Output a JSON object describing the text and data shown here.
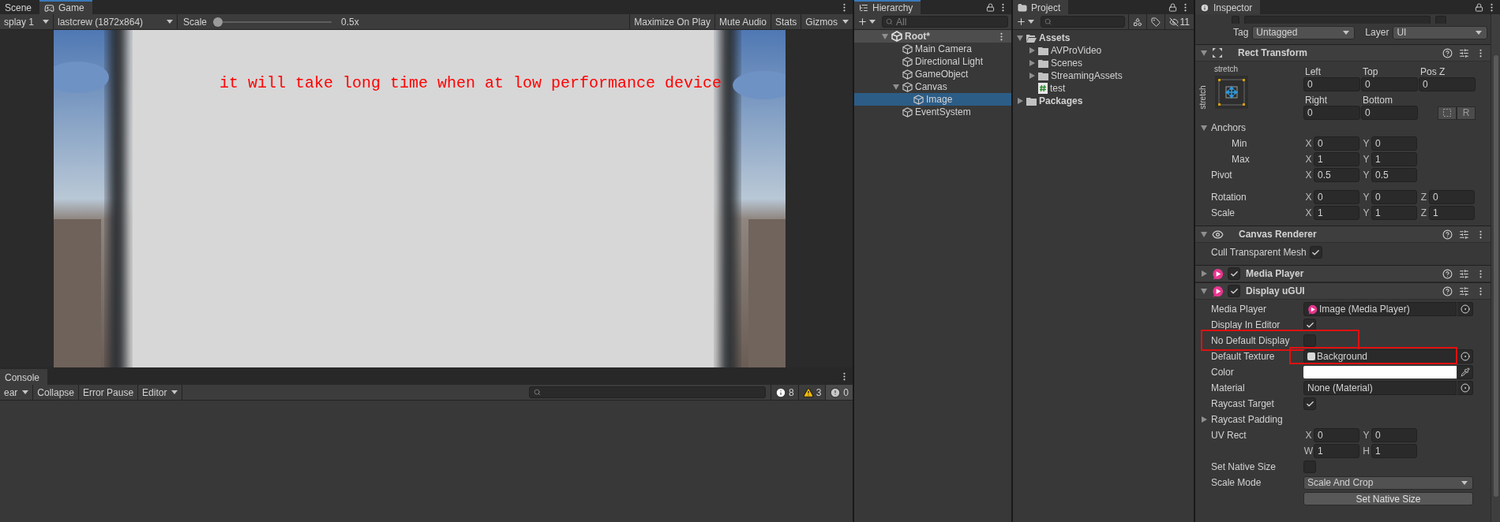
{
  "game_panel": {
    "tabs": [
      {
        "label": "Scene",
        "selected": false
      },
      {
        "label": "Game",
        "selected": true
      }
    ],
    "display": "splay 1",
    "resolution": "lastcrew (1872x864)",
    "scale": {
      "label": "Scale",
      "level": 0,
      "reading": "0.5x"
    },
    "toolbar_buttons": [
      {
        "label": "Maximize On Play",
        "dropdown": false
      },
      {
        "label": "Mute Audio",
        "dropdown": false
      },
      {
        "label": "Stats",
        "dropdown": false
      },
      {
        "label": "Gizmos",
        "dropdown": true
      }
    ],
    "game_text": "it will take long time when at low performance device"
  },
  "console": {
    "tab": "Console",
    "buttons": [
      {
        "label": "ear",
        "dropdown": true
      },
      {
        "label": "Collapse",
        "dropdown": false
      },
      {
        "label": "Error Pause",
        "dropdown": false
      },
      {
        "label": "Editor",
        "dropdown": true
      }
    ],
    "counts": [
      {
        "kind": "info",
        "value": "8"
      },
      {
        "kind": "warning",
        "value": "3"
      },
      {
        "kind": "error",
        "value": "0"
      }
    ]
  },
  "hierarchy": {
    "title": "Hierarchy",
    "search_placeholder": "All",
    "tree": [
      {
        "label": "Root*",
        "kind": "scene",
        "expanded": true,
        "selected": false,
        "children": [
          {
            "label": "Main Camera",
            "kind": "object",
            "selected": false
          },
          {
            "label": "Directional Light",
            "kind": "object",
            "selected": false
          },
          {
            "label": "GameObject",
            "kind": "object",
            "selected": false
          },
          {
            "label": "Canvas",
            "kind": "object",
            "selected": false,
            "expanded": true,
            "children": [
              {
                "label": "Image",
                "kind": "object",
                "selected": true
              }
            ]
          },
          {
            "label": "EventSystem",
            "kind": "object",
            "selected": false
          }
        ]
      }
    ]
  },
  "project": {
    "title": "Project",
    "hidden_count": "11",
    "tree": [
      {
        "label": "Assets",
        "kind": "folder",
        "expanded": true,
        "selected": false,
        "children": [
          {
            "label": "AVProVideo",
            "kind": "folder",
            "expanded": false,
            "selected": false
          },
          {
            "label": "Scenes",
            "kind": "folder",
            "expanded": false,
            "selected": false
          },
          {
            "label": "StreamingAssets",
            "kind": "folder",
            "expanded": false,
            "selected": false
          },
          {
            "label": "test",
            "kind": "script",
            "selected": false
          }
        ]
      },
      {
        "label": "Packages",
        "kind": "folder",
        "expanded": false,
        "selected": false
      }
    ]
  },
  "inspector": {
    "title": "Inspector",
    "tag_label": "Tag",
    "tag": "Untagged",
    "layer_label": "Layer",
    "layer": "UI",
    "components": [
      {
        "kind": "rect_transform",
        "title": "Rect Transform",
        "expanded": true,
        "preset": {
          "top": "stretch",
          "side": "stretch"
        },
        "offsets": [
          {
            "label": "Left",
            "value": "0"
          },
          {
            "label": "Top",
            "value": "0"
          },
          {
            "label": "Pos Z",
            "value": "0"
          },
          {
            "label": "Right",
            "value": "0"
          },
          {
            "label": "Bottom",
            "value": "0"
          }
        ],
        "raw_button": "R",
        "rows": [
          {
            "kind": "foldout",
            "label": "Anchors",
            "expanded": true,
            "children": [
              {
                "kind": "vector",
                "label": "Min",
                "fields": [
                  {
                    "axis": "X",
                    "value": "0"
                  },
                  {
                    "axis": "Y",
                    "value": "0"
                  }
                ]
              },
              {
                "kind": "vector",
                "label": "Max",
                "fields": [
                  {
                    "axis": "X",
                    "value": "1"
                  },
                  {
                    "axis": "Y",
                    "value": "1"
                  }
                ]
              }
            ]
          },
          {
            "kind": "vector",
            "label": "Pivot",
            "fields": [
              {
                "axis": "X",
                "value": "0.5"
              },
              {
                "axis": "Y",
                "value": "0.5"
              }
            ]
          }
        ],
        "transform_rows": [
          {
            "kind": "vector",
            "label": "Rotation",
            "fields": [
              {
                "axis": "X",
                "value": "0"
              },
              {
                "axis": "Y",
                "value": "0"
              },
              {
                "axis": "Z",
                "value": "0"
              }
            ]
          },
          {
            "kind": "vector",
            "label": "Scale",
            "fields": [
              {
                "axis": "X",
                "value": "1"
              },
              {
                "axis": "Y",
                "value": "1"
              },
              {
                "axis": "Z",
                "value": "1"
              }
            ]
          }
        ]
      },
      {
        "kind": "renderer",
        "title": "Canvas Renderer",
        "expanded": true,
        "rows": [
          {
            "kind": "check",
            "label": "Cull Transparent Mesh",
            "checked": true,
            "highlighted": false
          }
        ]
      },
      {
        "kind": "media",
        "title": "Media Player",
        "enabled": true,
        "expanded": false
      },
      {
        "kind": "media",
        "title": "Display uGUI",
        "enabled": true,
        "expanded": true,
        "rows": [
          {
            "kind": "media_object",
            "label": "Media Player",
            "value": "Image (Media Player)",
            "highlighted": false
          },
          {
            "kind": "check",
            "label": "Display In Editor",
            "checked": true,
            "highlighted": false
          },
          {
            "kind": "check",
            "label": "No Default Display",
            "checked": false,
            "highlighted": true
          },
          {
            "kind": "texture_object",
            "label": "Default Texture",
            "value": "Background",
            "highlighted": true
          },
          {
            "kind": "color",
            "label": "Color",
            "color": "#ffffff"
          },
          {
            "kind": "object",
            "label": "Material",
            "value": "None (Material)",
            "highlighted": false
          },
          {
            "kind": "check",
            "label": "Raycast Target",
            "checked": true,
            "highlighted": false
          },
          {
            "kind": "foldout",
            "label": "Raycast Padding",
            "expanded": false
          },
          {
            "kind": "vector",
            "label": "UV Rect",
            "fields": [
              {
                "axis": "X",
                "value": "0"
              },
              {
                "axis": "Y",
                "value": "0"
              }
            ]
          },
          {
            "kind": "vector",
            "fields": [
              {
                "axis": "W",
                "value": "1"
              },
              {
                "axis": "H",
                "value": "1"
              }
            ]
          },
          {
            "kind": "check",
            "label": "Set Native Size",
            "checked": false,
            "highlighted": false
          },
          {
            "kind": "dropdown",
            "label": "Scale Mode",
            "value": "Scale And Crop"
          },
          {
            "kind": "button",
            "label": "Set Native Size"
          }
        ]
      }
    ]
  }
}
